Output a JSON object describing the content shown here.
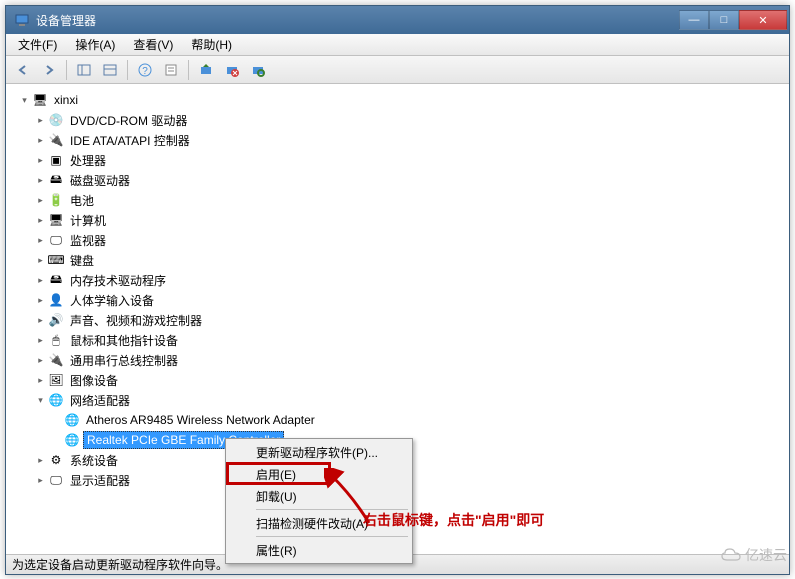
{
  "window": {
    "title": "设备管理器"
  },
  "winbtns": {
    "min": "—",
    "max": "□",
    "close": "✕"
  },
  "menubar": [
    {
      "label": "文件(F)"
    },
    {
      "label": "操作(A)"
    },
    {
      "label": "查看(V)"
    },
    {
      "label": "帮助(H)"
    }
  ],
  "toolbar_icons": {
    "back": "arrow-left-icon",
    "fwd": "arrow-right-icon",
    "up1": "panel-icon",
    "up2": "panel2-icon",
    "help": "help-icon",
    "props": "props-icon",
    "refresh": "refresh-icon",
    "scan": "scan-icon",
    "remove": "remove-icon",
    "enable": "enable-icon"
  },
  "tree": [
    {
      "level": 0,
      "exp": "▾",
      "icon": "🖥",
      "label": "xinxi"
    },
    {
      "level": 1,
      "exp": "▸",
      "icon": "💿",
      "label": "DVD/CD-ROM 驱动器"
    },
    {
      "level": 1,
      "exp": "▸",
      "icon": "🔌",
      "label": "IDE ATA/ATAPI 控制器"
    },
    {
      "level": 1,
      "exp": "▸",
      "icon": "▣",
      "label": "处理器"
    },
    {
      "level": 1,
      "exp": "▸",
      "icon": "🖴",
      "label": "磁盘驱动器"
    },
    {
      "level": 1,
      "exp": "▸",
      "icon": "🔋",
      "label": "电池"
    },
    {
      "level": 1,
      "exp": "▸",
      "icon": "🖥",
      "label": "计算机"
    },
    {
      "level": 1,
      "exp": "▸",
      "icon": "🖵",
      "label": "监视器"
    },
    {
      "level": 1,
      "exp": "▸",
      "icon": "⌨",
      "label": "键盘"
    },
    {
      "level": 1,
      "exp": "▸",
      "icon": "🖴",
      "label": "内存技术驱动程序"
    },
    {
      "level": 1,
      "exp": "▸",
      "icon": "👤",
      "label": "人体学输入设备"
    },
    {
      "level": 1,
      "exp": "▸",
      "icon": "🔊",
      "label": "声音、视频和游戏控制器"
    },
    {
      "level": 1,
      "exp": "▸",
      "icon": "🖱",
      "label": "鼠标和其他指针设备"
    },
    {
      "level": 1,
      "exp": "▸",
      "icon": "🔌",
      "label": "通用串行总线控制器"
    },
    {
      "level": 1,
      "exp": "▸",
      "icon": "🖼",
      "label": "图像设备"
    },
    {
      "level": 1,
      "exp": "▾",
      "icon": "🌐",
      "label": "网络适配器"
    },
    {
      "level": 2,
      "exp": "",
      "icon": "🌐",
      "label": "Atheros AR9485 Wireless Network Adapter"
    },
    {
      "level": 2,
      "exp": "",
      "icon": "🌐",
      "label": "Realtek PCIe GBE Family Controller",
      "selected": true
    },
    {
      "level": 1,
      "exp": "▸",
      "icon": "⚙",
      "label": "系统设备"
    },
    {
      "level": 1,
      "exp": "▸",
      "icon": "🖵",
      "label": "显示适配器"
    }
  ],
  "context_menu": [
    {
      "label": "更新驱动程序软件(P)...",
      "type": "item"
    },
    {
      "label": "启用(E)",
      "type": "item",
      "highlight": true
    },
    {
      "label": "卸载(U)",
      "type": "item"
    },
    {
      "type": "sep"
    },
    {
      "label": "扫描检测硬件改动(A)",
      "type": "item"
    },
    {
      "type": "sep"
    },
    {
      "label": "属性(R)",
      "type": "item"
    }
  ],
  "annotation": "右击鼠标键，点击\"启用\"即可",
  "statusbar": "为选定设备启动更新驱动程序软件向导。",
  "watermark": "亿速云"
}
